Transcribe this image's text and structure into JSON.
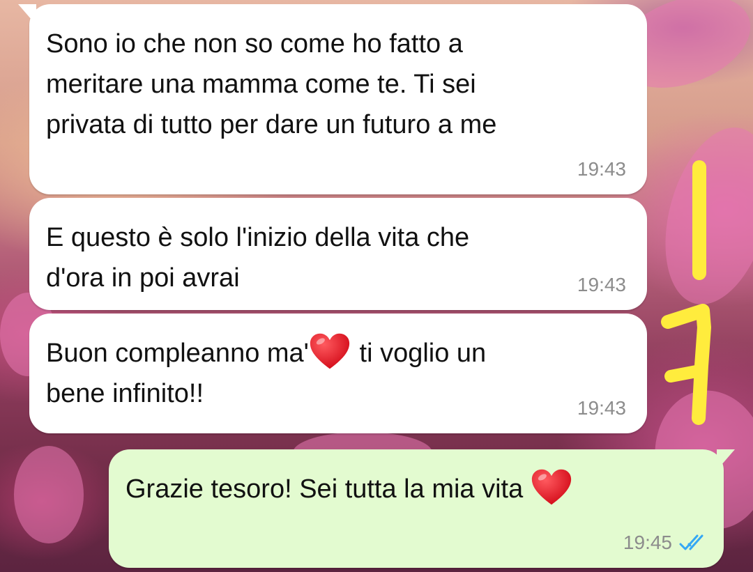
{
  "colors": {
    "incoming_bubble": "#ffffff",
    "outgoing_bubble": "#e3fbd0",
    "time_text": "#8c8c8c",
    "read_ticks": "#34a7f5",
    "annotation_highlight": "#ffec3d",
    "heart": "#e0121f"
  },
  "messages": [
    {
      "direction": "incoming",
      "text": "Sono io che non so come ho fatto a\nmeritare una mamma come te. Ti sei\nprivata di tutto per dare un futuro a me",
      "time": "19:43"
    },
    {
      "direction": "incoming",
      "text": "E questo è solo l'inizio della vita che\nd'ora in poi avrai",
      "time": "19:43"
    },
    {
      "direction": "incoming",
      "text_before_emoji": "Buon compleanno ma'",
      "emoji": "heart-icon",
      "text_after_emoji": " ti voglio un\nbene infinito!!",
      "time": "19:43"
    },
    {
      "direction": "outgoing",
      "text": "Grazie tesoro! Sei tutta la mia vita ",
      "emoji": "heart-icon",
      "time": "19:45",
      "status_icon": "double-check-icon"
    }
  ]
}
